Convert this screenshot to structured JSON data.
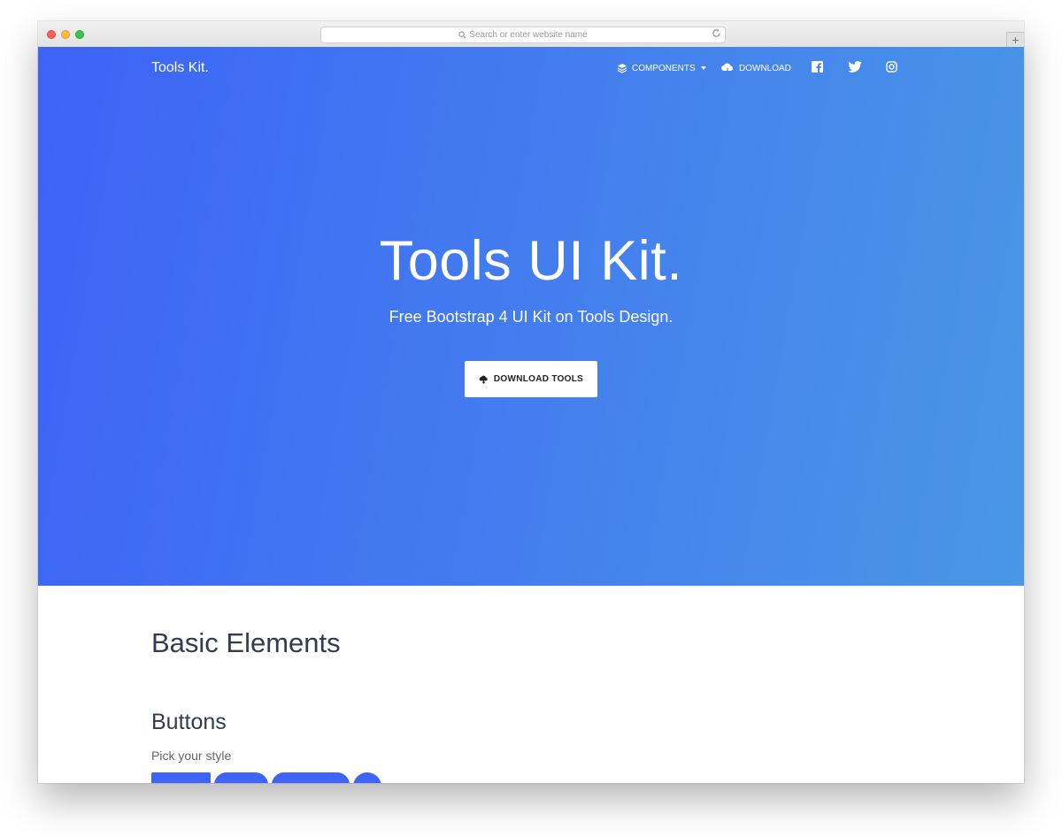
{
  "browser": {
    "url_placeholder": "Search or enter website name",
    "new_tab_label": "+"
  },
  "nav": {
    "brand": "Tools Kit.",
    "items": [
      {
        "label": "COMPONENTS",
        "icon": "layers-icon",
        "has_dropdown": true
      },
      {
        "label": "DOWNLOAD",
        "icon": "cloud-download-icon"
      }
    ],
    "social": [
      "facebook-icon",
      "twitter-icon",
      "instagram-icon"
    ]
  },
  "hero": {
    "title": "Tools UI Kit.",
    "subtitle": "Free Bootstrap 4 UI Kit on Tools Design.",
    "button_label": "DOWNLOAD TOOLS",
    "gradient_start": "#3d63f7",
    "gradient_end": "#4a97e6"
  },
  "content": {
    "section_title": "Basic Elements",
    "buttons_title": "Buttons",
    "buttons_subtitle": "Pick your style",
    "button_color": "#3d63f7"
  }
}
